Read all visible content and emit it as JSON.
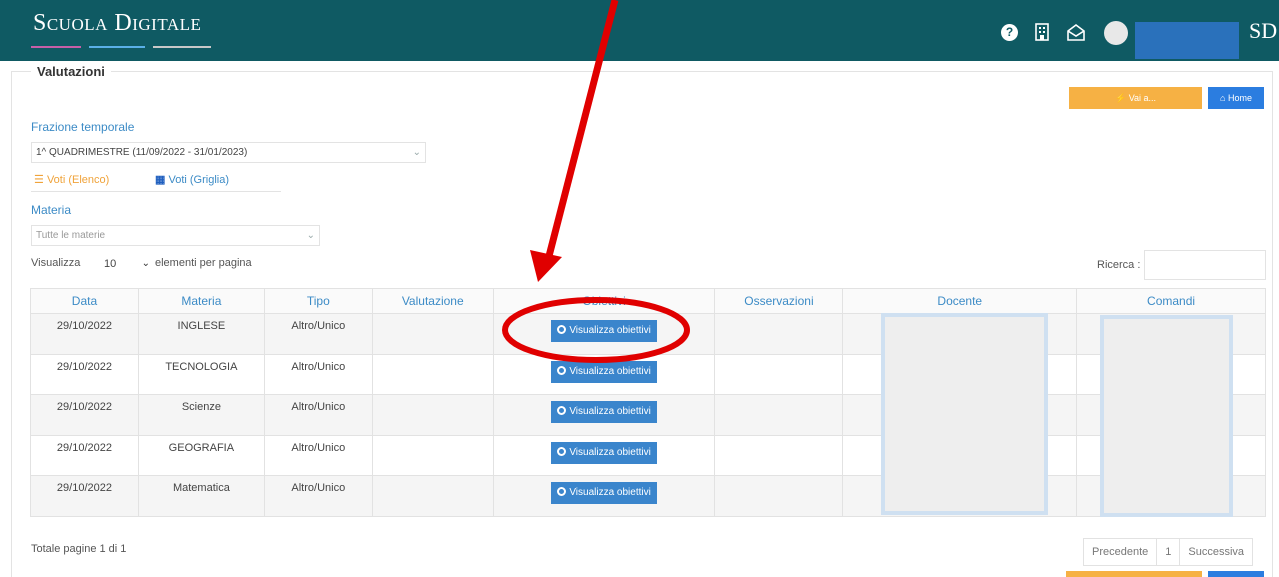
{
  "app": {
    "brand": "Scuola Digitale",
    "logo_short": "SD"
  },
  "topbar": {
    "help_icon": "?",
    "icons": [
      "help-icon",
      "building-icon",
      "mail-icon"
    ]
  },
  "section": {
    "legend": "Valutazioni"
  },
  "actions": {
    "vai_label": "Vai a...",
    "home_label": "Home"
  },
  "filters": {
    "period_label": "Frazione temporale",
    "period_value": "1^ QUADRIMESTRE (11/09/2022 - 31/01/2023)",
    "subject_label": "Materia",
    "subject_placeholder": "Tutte le materie"
  },
  "tabs": [
    {
      "label": "Voti (Elenco)",
      "active": true
    },
    {
      "label": "Voti (Griglia)",
      "active": false
    }
  ],
  "paging": {
    "show_prefix": "Visualizza",
    "page_size": "10",
    "show_suffix": "elementi per pagina",
    "search_label": "Ricerca :",
    "total": "Totale pagine 1 di 1",
    "prev": "Precedente",
    "current": "1",
    "next": "Successiva"
  },
  "table": {
    "columns": [
      "Data",
      "Materia",
      "Tipo",
      "Valutazione",
      "Obiettivi",
      "Osservazioni",
      "Docente",
      "Comandi"
    ],
    "button_label": "Visualizza obiettivi",
    "rows": [
      {
        "date": "29/10/2022",
        "subject": "INGLESE",
        "type": "Altro/Unico"
      },
      {
        "date": "29/10/2022",
        "subject": "TECNOLOGIA",
        "type": "Altro/Unico"
      },
      {
        "date": "29/10/2022",
        "subject": "Scienze",
        "type": "Altro/Unico"
      },
      {
        "date": "29/10/2022",
        "subject": "GEOGRAFIA",
        "type": "Altro/Unico"
      },
      {
        "date": "29/10/2022",
        "subject": "Matematica",
        "type": "Altro/Unico"
      }
    ]
  },
  "colors": {
    "topbar": "#0f5a63",
    "accent_orange": "#f6b144",
    "accent_blue": "#2b7de0",
    "annotation_red": "#e00000"
  }
}
